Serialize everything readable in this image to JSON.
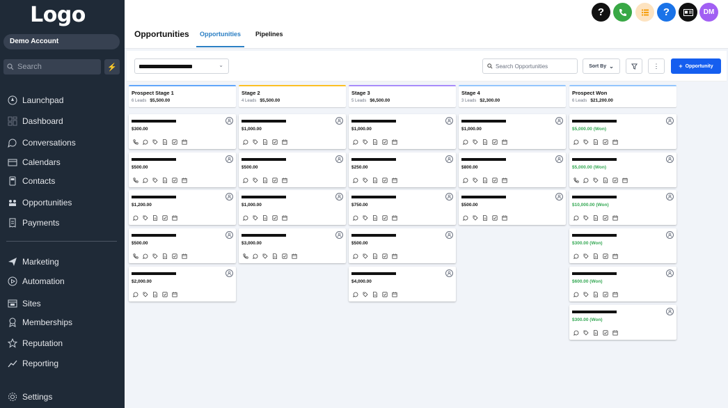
{
  "sidebar": {
    "logo": "Logo",
    "account": "Demo Account",
    "search_placeholder": "Search",
    "items": [
      {
        "label": "Launchpad",
        "icon": "rocket-icon"
      },
      {
        "label": "Dashboard",
        "icon": "dashboard-icon"
      },
      {
        "label": "Conversations",
        "icon": "chat-icon"
      },
      {
        "label": "Calendars",
        "icon": "calendar-icon"
      },
      {
        "label": "Contacts",
        "icon": "contacts-icon"
      },
      {
        "label": "Opportunities",
        "icon": "funnel-icon"
      },
      {
        "label": "Payments",
        "icon": "receipt-icon"
      },
      {
        "label": "Marketing",
        "icon": "send-icon"
      },
      {
        "label": "Automation",
        "icon": "play-circle-icon"
      },
      {
        "label": "Sites",
        "icon": "browser-icon"
      },
      {
        "label": "Memberships",
        "icon": "badge-icon"
      },
      {
        "label": "Reputation",
        "icon": "star-icon"
      },
      {
        "label": "Reporting",
        "icon": "chart-line-icon"
      },
      {
        "label": "Settings",
        "icon": "gear-icon"
      }
    ]
  },
  "header": {
    "title": "Opportunities",
    "tabs": [
      {
        "label": "Opportunities"
      },
      {
        "label": "Pipelines"
      }
    ],
    "icons": [
      {
        "name": "help-icon",
        "text": "?",
        "color": "#111111"
      },
      {
        "name": "phone-icon",
        "text": "",
        "color": "#39a845"
      },
      {
        "name": "task-list-icon",
        "text": "",
        "color": "#fde3c0"
      },
      {
        "name": "support-icon",
        "text": "?",
        "color": "#1a73e8"
      },
      {
        "name": "id-card-icon",
        "text": "",
        "color": "#111111"
      }
    ],
    "user_initials": "DM",
    "user_color": "#a15ff3"
  },
  "toolbar": {
    "search_placeholder": "Search Opportunities",
    "sort_label": "Sort By",
    "add_label": "Opportunity"
  },
  "colors": {
    "accent": "#155eef",
    "won": "#34a853",
    "tab_active": "#2b7fc4"
  },
  "board": {
    "columns": [
      {
        "title": "Prospect Stage 1",
        "leads": "6 Leads",
        "total": "$5,500.00",
        "color": "#60a5fa",
        "cards": [
          {
            "amount": "$300.00",
            "won": false,
            "icons": 6
          },
          {
            "amount": "$500.00",
            "won": false,
            "icons": 6
          },
          {
            "amount": "$1,200.00",
            "won": false,
            "icons": 5
          },
          {
            "amount": "$500.00",
            "won": false,
            "icons": 6
          },
          {
            "amount": "$2,000.00",
            "won": false,
            "icons": 5
          }
        ]
      },
      {
        "title": "Stage 2",
        "leads": "4 Leads",
        "total": "$5,500.00",
        "color": "#fbbf24",
        "cards": [
          {
            "amount": "$1,000.00",
            "won": false,
            "icons": 5
          },
          {
            "amount": "$500.00",
            "won": false,
            "icons": 5
          },
          {
            "amount": "$1,000.00",
            "won": false,
            "icons": 5
          },
          {
            "amount": "$3,000.00",
            "won": false,
            "icons": 6
          }
        ]
      },
      {
        "title": "Stage 3",
        "leads": "5 Leads",
        "total": "$6,500.00",
        "color": "#a78bfa",
        "cards": [
          {
            "amount": "$1,000.00",
            "won": false,
            "icons": 5
          },
          {
            "amount": "$250.00",
            "won": false,
            "icons": 5
          },
          {
            "amount": "$750.00",
            "won": false,
            "icons": 5
          },
          {
            "amount": "$500.00",
            "won": false,
            "icons": 5
          },
          {
            "amount": "$4,000.00",
            "won": false,
            "icons": 5
          }
        ]
      },
      {
        "title": "Stage 4",
        "leads": "3 Leads",
        "total": "$2,300.00",
        "color": "#93c5fd",
        "cards": [
          {
            "amount": "$1,000.00",
            "won": false,
            "icons": 5
          },
          {
            "amount": "$800.00",
            "won": false,
            "icons": 5
          },
          {
            "amount": "$500.00",
            "won": false,
            "icons": 5
          }
        ]
      },
      {
        "title": "Prospect Won",
        "leads": "6 Leads",
        "total": "$21,200.00",
        "color": "#93c5fd",
        "cards": [
          {
            "amount": "$5,000.00 (Won)",
            "won": true,
            "icons": 5
          },
          {
            "amount": "$5,000.00 (Won)",
            "won": true,
            "icons": 6
          },
          {
            "amount": "$10,000.00 (Won)",
            "won": true,
            "icons": 5
          },
          {
            "amount": "$300.00 (Won)",
            "won": true,
            "icons": 5
          },
          {
            "amount": "$600.00 (Won)",
            "won": true,
            "icons": 5
          },
          {
            "amount": "$300.00 (Won)",
            "won": true,
            "icons": 5
          }
        ]
      }
    ]
  }
}
